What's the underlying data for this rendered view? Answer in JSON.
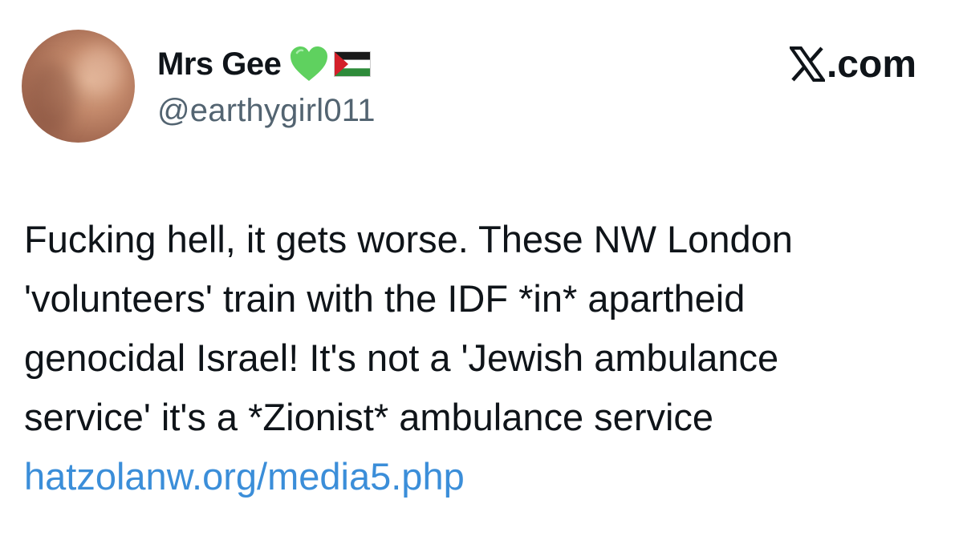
{
  "author": {
    "display_name": "Mrs Gee",
    "handle": "@earthygirl011",
    "badges": [
      "green-heart-icon",
      "palestine-flag-icon"
    ]
  },
  "brand": {
    "logo": "x-logo-icon",
    "suffix": ".com"
  },
  "tweet": {
    "lines": [
      "Fucking hell, it gets worse. These NW London",
      "'volunteers' train with the IDF *in* apartheid",
      "genocidal Israel! It's not a 'Jewish ambulance",
      "service' it's a *Zionist* ambulance service"
    ],
    "link_text": "hatzolanw.org/media5.php"
  },
  "colors": {
    "text": "#0f1419",
    "handle": "#536471",
    "link": "#3b8ed9",
    "heart": "#5fd15f",
    "background": "#ffffff"
  }
}
